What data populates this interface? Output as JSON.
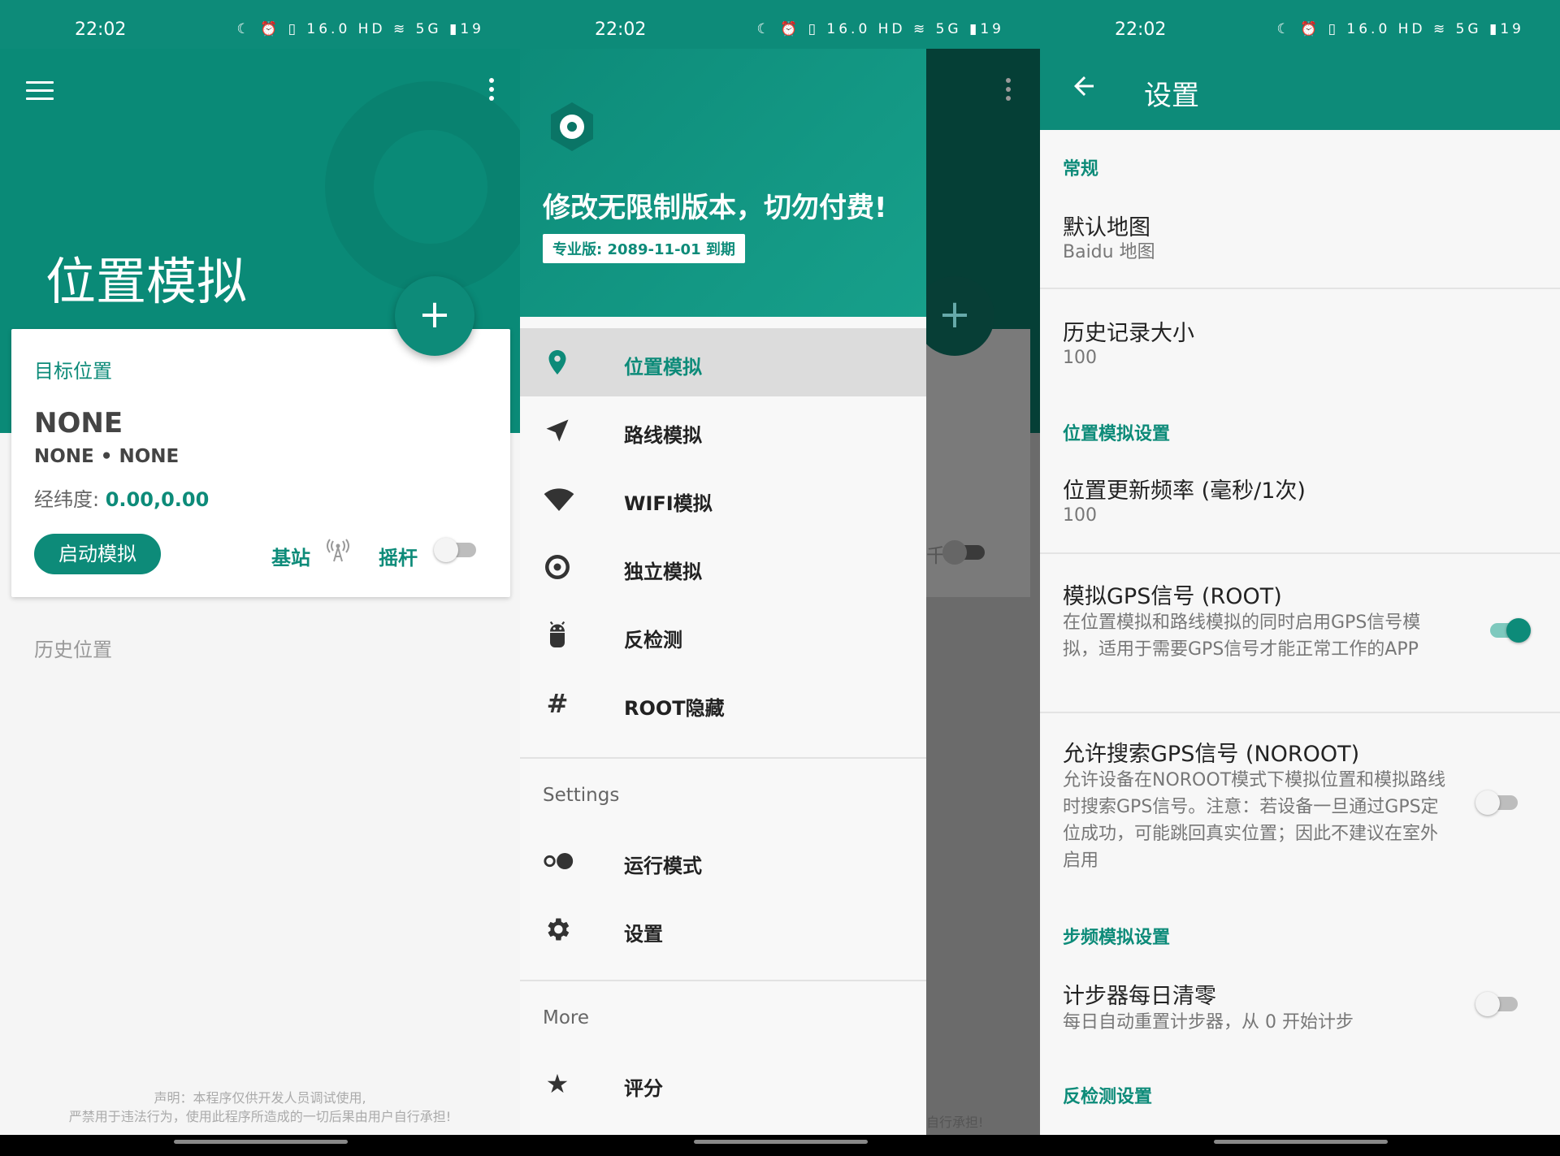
{
  "status": {
    "time": "22:02",
    "icons": "☾ ⏰ ▯ 16.0 HD ≋ 5G ▮19"
  },
  "colors": {
    "accent": "#0d8b79"
  },
  "main": {
    "title": "位置模拟",
    "card_label": "目标位置",
    "place_name": "NONE",
    "place_sub": "NONE • NONE",
    "coord_label": "经纬度:",
    "coord_value": "0.00,0.00",
    "start_button": "启动模拟",
    "base_station": "基站",
    "joystick": "摇杆",
    "fab": "+",
    "history": "历史位置",
    "disclaimer_1": "声明：本程序仅供开发人员调试使用,",
    "disclaimer_2": "严禁用于违法行为，使用此程序所造成的一切后果由用户自行承担!"
  },
  "drawer": {
    "promo": "修改无限制版本，切勿付费!",
    "badge": "专业版: 2089-11-01 到期",
    "items": [
      {
        "label": "位置模拟",
        "icon": "location-pin-icon"
      },
      {
        "label": "路线模拟",
        "icon": "navigation-arrow-icon"
      },
      {
        "label": "WIFI模拟",
        "icon": "wifi-icon"
      },
      {
        "label": "独立模拟",
        "icon": "radio-target-icon"
      },
      {
        "label": "反检测",
        "icon": "android-icon"
      },
      {
        "label": "ROOT隐藏",
        "icon": "hash-icon"
      }
    ],
    "settings_header": "Settings",
    "settings_items": [
      {
        "label": "运行模式",
        "icon": "toggle-dots-icon"
      },
      {
        "label": "设置",
        "icon": "gear-icon"
      }
    ],
    "more_header": "More",
    "more_items": [
      {
        "label": "评分",
        "icon": "star-icon"
      }
    ],
    "scrim_text_1": "千",
    "scrim_text_2": "自行承担!"
  },
  "settings": {
    "title": "设置",
    "cat_general": "常规",
    "default_map_title": "默认地图",
    "default_map_value": "Baidu 地图",
    "history_size_title": "历史记录大小",
    "history_size_value": "100",
    "cat_location": "位置模拟设置",
    "update_rate_title": "位置更新频率 (毫秒/1次)",
    "update_rate_value": "100",
    "gps_root_title": "模拟GPS信号 (ROOT)",
    "gps_root_desc": "在位置模拟和路线模拟的同时启用GPS信号模拟，适用于需要GPS信号才能正常工作的APP",
    "gps_root_on": true,
    "gps_noroot_title": "允许搜索GPS信号 (NOROOT)",
    "gps_noroot_desc": "允许设备在NOROOT模式下模拟位置和模拟路线时搜索GPS信号。注意：若设备一旦通过GPS定位成功，可能跳回真实位置；因此不建议在室外启用",
    "gps_noroot_on": false,
    "cat_step": "步频模拟设置",
    "step_reset_title": "计步器每日清零",
    "step_reset_desc": "每日自动重置计步器，从 0 开始计步",
    "step_reset_on": false,
    "cat_antidetect": "反检测设置"
  }
}
